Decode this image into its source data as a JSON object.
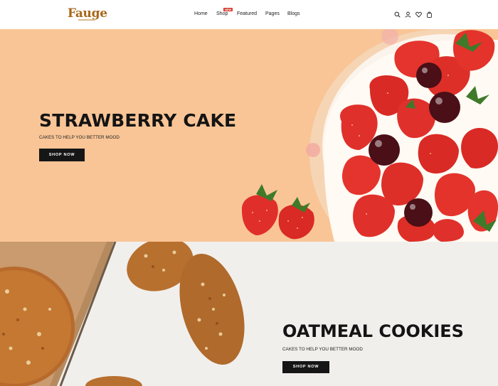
{
  "brand": {
    "logo_text": "Fauge"
  },
  "nav": {
    "items": [
      {
        "label": "Home"
      },
      {
        "label": "Shop"
      },
      {
        "label": "Featured"
      },
      {
        "label": "Pages"
      },
      {
        "label": "Blogs"
      }
    ],
    "shop_badge": "NEW"
  },
  "header_icons": [
    "search-icon",
    "user-icon",
    "heart-icon",
    "bag-icon"
  ],
  "hero1": {
    "title": "STRAWBERRY CAKE",
    "subtitle": "CAKES TO HELP YOU BETTER MOOD",
    "button": "SHOP NOW",
    "bg_color": "#f9c596"
  },
  "hero2": {
    "title": "OATMEAL COOKIES",
    "subtitle": "CAKES TO HELP YOU BETTER MOOD",
    "button": "SHOP NOW",
    "bg_color": "#f1efec"
  },
  "colors": {
    "accent": "#a8671b",
    "button_bg": "#161616",
    "badge": "#d63a2e"
  }
}
